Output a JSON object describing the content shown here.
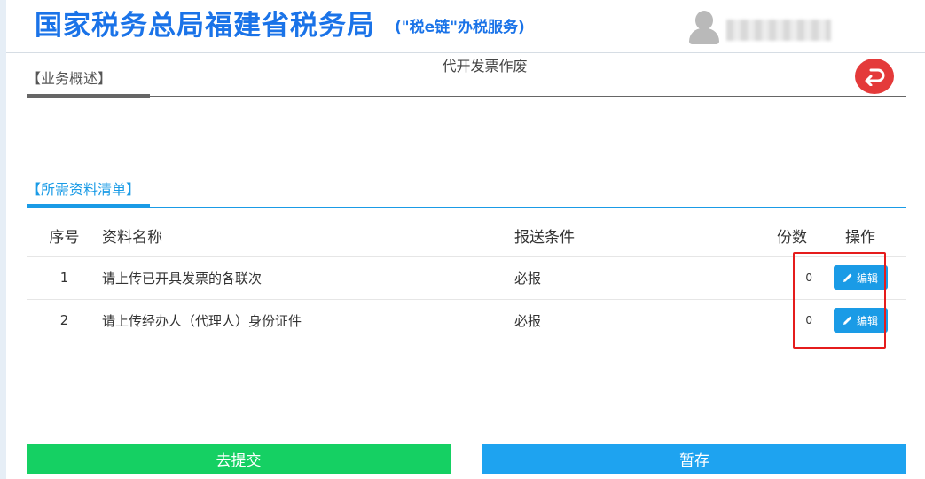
{
  "header": {
    "title": "国家税务总局福建省税务局",
    "subtitle": "(\"税e链\"办税服务)",
    "user_avatar_icon": "user-avatar-icon"
  },
  "page": {
    "heading": "代开发票作废",
    "return_icon": "return-arrow-icon"
  },
  "sections": {
    "overview_tab": "【业务概述】",
    "materials_tab": "【所需资料清单】"
  },
  "table": {
    "headers": {
      "seq": "序号",
      "name": "资料名称",
      "condition": "报送条件",
      "count": "份数",
      "action": "操作"
    },
    "rows": [
      {
        "seq": "1",
        "name": "请上传已开具发票的各联次",
        "condition": "必报",
        "count": "0",
        "action": "编辑"
      },
      {
        "seq": "2",
        "name": "请上传经办人（代理人）身份证件",
        "condition": "必报",
        "count": "0",
        "action": "编辑"
      }
    ]
  },
  "footer": {
    "submit_label": "去提交",
    "save_label": "暂存"
  },
  "colors": {
    "brand_blue": "#1a73e8",
    "accent_blue": "#1a9be6",
    "submit_green": "#15d063",
    "return_red": "#e43a3a",
    "highlight_red": "#e51c1c"
  }
}
